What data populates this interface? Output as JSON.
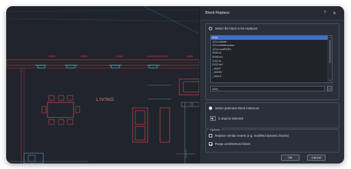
{
  "canvas": {
    "room_label": "LIVING",
    "dim_labels": [
      "ndtdk",
      "ndtdk",
      "ndtdk",
      "frameworkneddk",
      "ndtdk"
    ],
    "colors": {
      "background": "#1f242d",
      "wall_line": "#c63c3c",
      "furniture": "#e04545",
      "cyan": "#66c6d6"
    }
  },
  "dialog": {
    "title": "Block Replace",
    "help_label": "?",
    "close_label": "✕",
    "section1": {
      "radio_label": "Select the block to be replaced",
      "list_items": [
        "0001",
        "1214-leftwin",
        "1214-leftwincolour",
        "1214-rectRGRL",
        "2045-in",
        "2045-in1",
        "2112-in",
        "2112-in1",
        "_ArchT",
        "_AcDim",
        "_Annot"
      ],
      "selected_index": 0,
      "field_value": "0001",
      "pick_label": "…"
    },
    "section2": {
      "radio_label": "Select particular block instances",
      "selected_label": "5 objects selected"
    },
    "options": {
      "legend": "Options",
      "replace_label": "Replace similar inserts (e.g. modified dynamic blocks)",
      "replace_checked": false,
      "purge_label": "Purge unreferenced block",
      "purge_checked": true
    },
    "ok_label": "OK",
    "cancel_label": "Cancel",
    "accent": "#3d6fd3"
  }
}
